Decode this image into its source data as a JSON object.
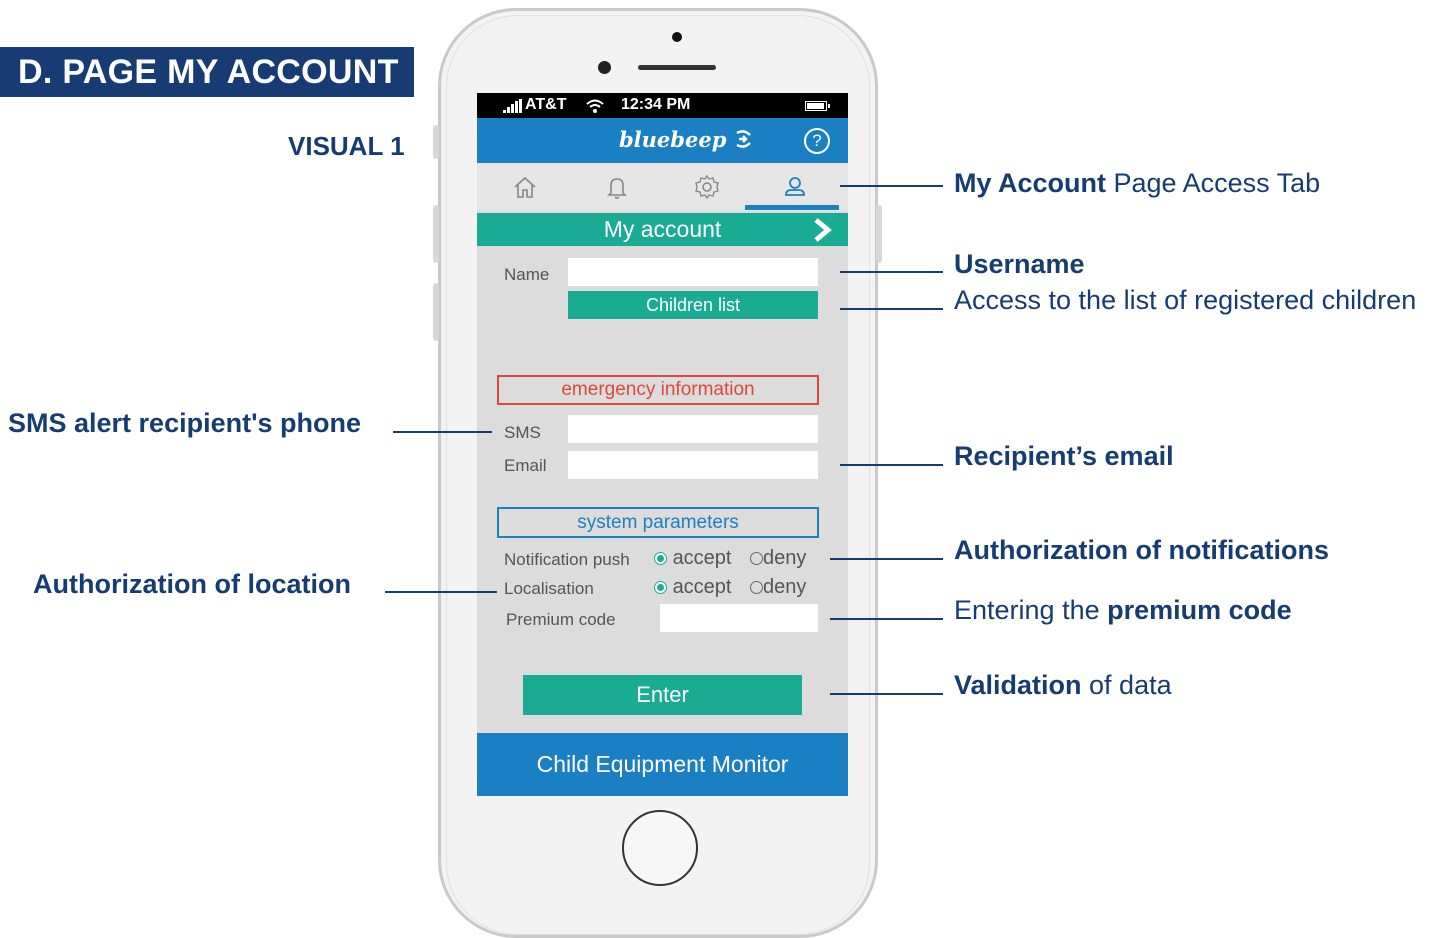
{
  "header": {
    "title": "D. PAGE MY ACCOUNT",
    "visual_label": "VISUAL 1"
  },
  "status_bar": {
    "carrier": "AT&T",
    "time": "12:34 PM"
  },
  "app": {
    "brand": "bluebeep",
    "help_symbol": "?",
    "tabs": [
      {
        "name": "home",
        "icon": "home-icon"
      },
      {
        "name": "notifications",
        "icon": "bell-icon"
      },
      {
        "name": "settings",
        "icon": "gear-icon"
      },
      {
        "name": "account",
        "icon": "user-icon",
        "active": true
      }
    ],
    "section_title": "My account",
    "form": {
      "name_label": "Name",
      "name_value": "",
      "children_button": "Children list",
      "emergency_heading": "emergency information",
      "sms_label": "SMS",
      "sms_value": "",
      "email_label": "Email",
      "email_value": "",
      "system_heading": "system parameters",
      "notification_label": "Notification push",
      "localisation_label": "Localisation",
      "accept_label": "accept",
      "deny_label": "deny",
      "premium_label": "Premium code",
      "premium_value": "",
      "enter_button": "Enter"
    },
    "footer": "Child Equipment Monitor"
  },
  "annotations": {
    "my_account_tab": {
      "bold": "My Account",
      "rest": " Page Access Tab"
    },
    "username": {
      "bold": "Username"
    },
    "children_access": {
      "text": "Access to the list of registered children"
    },
    "sms_phone": {
      "bold": "SMS alert recipient's phone"
    },
    "recipient_email": {
      "bold": "Recipient’s email"
    },
    "auth_notifications": {
      "bold": "Authorization of notifications"
    },
    "auth_location": {
      "bold": "Authorization of location"
    },
    "premium": {
      "pre": "Entering the ",
      "bold": "premium code"
    },
    "validation": {
      "bold": "Validation",
      "rest": " of data"
    }
  },
  "colors": {
    "navy": "#173b73",
    "blue": "#1b7fc4",
    "teal": "#1aab94",
    "red": "#e0463a"
  }
}
